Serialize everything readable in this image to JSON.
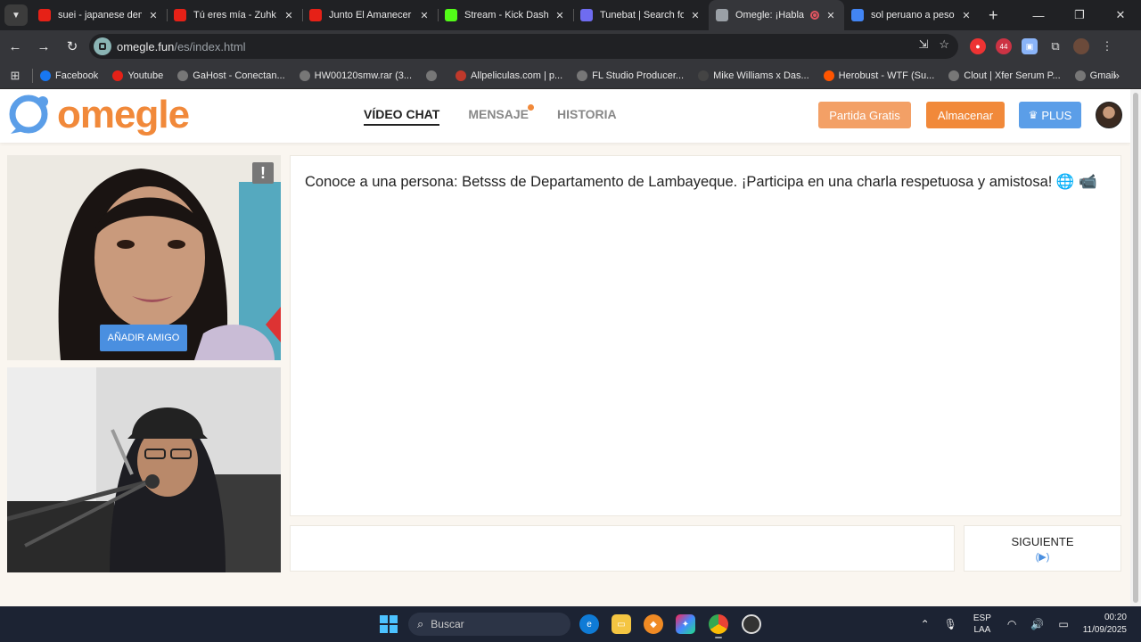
{
  "browser": {
    "tabs": [
      {
        "title": "suei - japanese dem",
        "icon": "youtube-icon",
        "color": "#e62117"
      },
      {
        "title": "Tú eres mía - Zuhk ft",
        "icon": "youtube-icon",
        "color": "#e62117"
      },
      {
        "title": "Junto El Amanecer -",
        "icon": "youtube-icon",
        "color": "#e62117"
      },
      {
        "title": "Stream - Kick Dashbo",
        "icon": "kick-icon",
        "color": "#53fc18"
      },
      {
        "title": "Tunebat | Search for",
        "icon": "tunebat-icon",
        "color": "#6f6cf0"
      },
      {
        "title": "Omegle: ¡Habla c",
        "icon": "globe-icon",
        "color": "#9aa0a6",
        "active": true
      },
      {
        "title": "sol peruano a peso n",
        "icon": "google-icon",
        "color": "#4285f4"
      }
    ],
    "url_host": "omegle.fun",
    "url_path": "/es/index.html",
    "extension_badge": "44",
    "bookmarks": [
      {
        "label": "Facebook",
        "icon": "facebook-icon",
        "color": "#1877f2"
      },
      {
        "label": "Youtube",
        "icon": "youtube-icon",
        "color": "#e62117"
      },
      {
        "label": "GaHost - Conectan...",
        "icon": "globe-icon",
        "color": "#777"
      },
      {
        "label": "HW00120smw.rar (3...",
        "icon": "globe-icon",
        "color": "#777"
      },
      {
        "label": "",
        "icon": "globe-icon",
        "color": "#777"
      },
      {
        "label": "Allpeliculas.com | p...",
        "icon": "allpeliculas-icon",
        "color": "#c0392b"
      },
      {
        "label": "FL Studio Producer...",
        "icon": "globe-icon",
        "color": "#777"
      },
      {
        "label": "Mike Williams x Das...",
        "icon": "globe-icon",
        "color": "#444"
      },
      {
        "label": "Herobust - WTF (Su...",
        "icon": "soundcloud-icon",
        "color": "#ff5500"
      },
      {
        "label": "Clout | Xfer Serum P...",
        "icon": "globe-icon",
        "color": "#777"
      },
      {
        "label": "Gmail",
        "icon": "globe-icon",
        "color": "#777"
      }
    ]
  },
  "site": {
    "logo_text": "omegle",
    "nav": [
      {
        "label": "VÍDEO CHAT",
        "active": true
      },
      {
        "label": "MENSAJE",
        "dot": true
      },
      {
        "label": "HISTORIA"
      }
    ],
    "btn_partida": "Partida Gratis",
    "btn_almacenar": "Almacenar",
    "btn_plus": "PLUS",
    "report_symbol": "!",
    "add_friend": "AÑADIR AMIGO",
    "chat_message": "Conoce a una persona: Betsss de Departamento de Lambayeque. ¡Participa en una charla respetuosa y amistosa! 🌐 📹",
    "next_label": "SIGUIENTE",
    "next_hint": "(▶)"
  },
  "taskbar": {
    "search_placeholder": "Buscar",
    "lang_top": "ESP",
    "lang_bottom": "LAA",
    "time": "00:20",
    "date": "11/09/2025"
  },
  "colors": {
    "brand_orange": "#f1893a",
    "plus_blue": "#5b9ee8"
  }
}
